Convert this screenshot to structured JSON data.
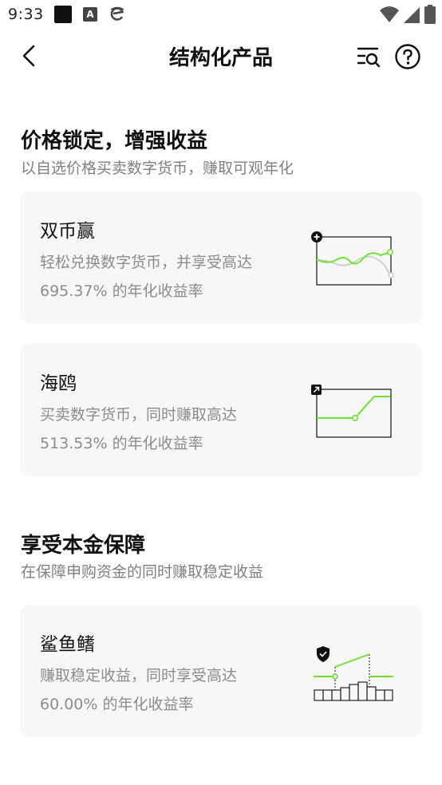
{
  "status_bar": {
    "time": "9:33",
    "icons": [
      "app-square-icon",
      "a-letter-icon",
      "browser-e-icon",
      "wifi-icon",
      "signal-icon",
      "battery-icon"
    ]
  },
  "header": {
    "title": "结构化产品",
    "icons": [
      "back-arrow-icon",
      "search-list-icon",
      "help-circle-icon"
    ]
  },
  "sections": [
    {
      "title": "价格锁定，增强收益",
      "subtitle": "以自选价格买卖数字货币，赚取可观年化",
      "cards": [
        {
          "name": "双币赢",
          "desc_line1": "轻松兑换数字货币，并享受高达",
          "desc_line2": "695.37% 的年化收益率",
          "illustration": "dual-currency-wave-icon"
        },
        {
          "name": "海鸥",
          "desc_line1": "买卖数字货币，同时赚取高达",
          "desc_line2": "513.53% 的年化收益率",
          "illustration": "seagull-step-icon"
        }
      ]
    },
    {
      "title": "享受本金保障",
      "subtitle": "在保障申购资金的同时赚取稳定收益",
      "cards": [
        {
          "name": "鲨鱼鳍",
          "desc_line1": "赚取稳定收益，同时享受高达",
          "desc_line2": "60.00% 的年化收益率",
          "illustration": "shark-fin-shield-icon"
        }
      ]
    }
  ],
  "colors": {
    "accent_green": "#6fe332",
    "card_bg": "#f7f7f7",
    "text_primary": "#111111",
    "text_secondary": "#8c8c8c"
  }
}
